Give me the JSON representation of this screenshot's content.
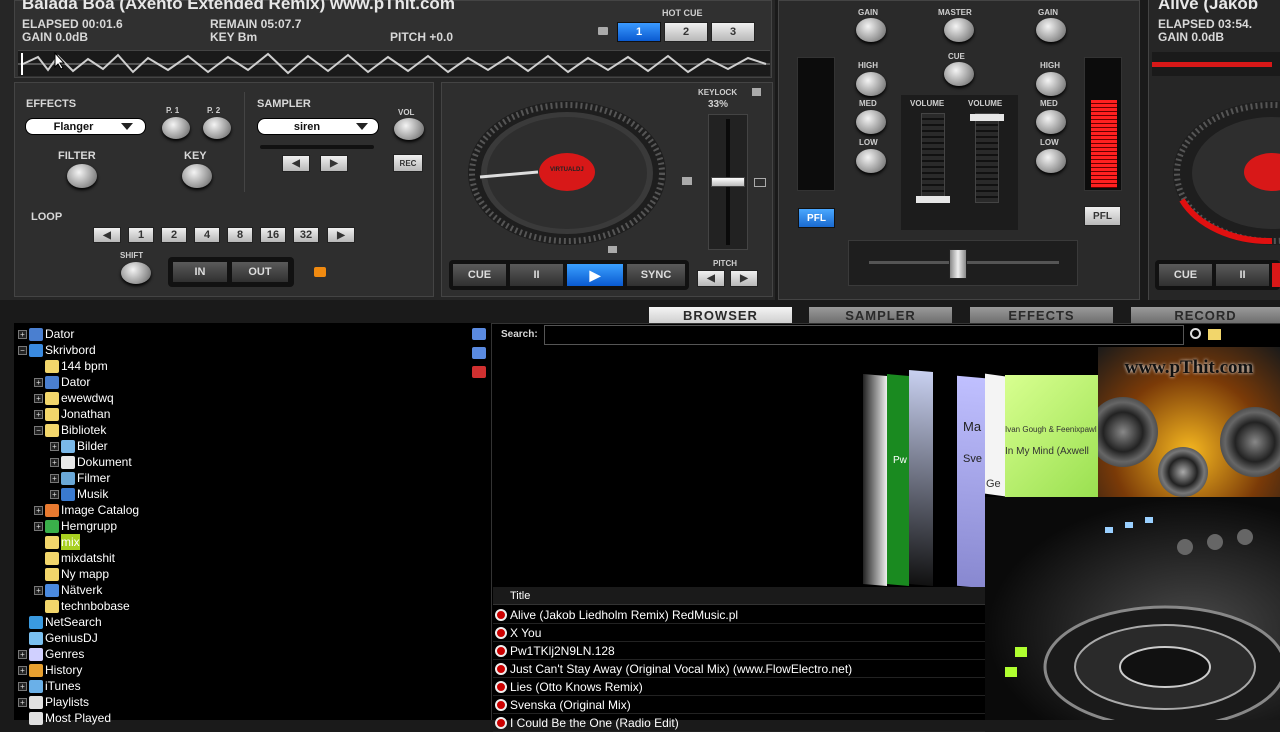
{
  "deck_left": {
    "title": "Balada Boa (Axento Extended Remix) www.pThit.com",
    "elapsed": "ELAPSED 00:01.6",
    "remain": "REMAIN 05:07.7",
    "gain": "GAIN 0.0dB",
    "key": "KEY Bm",
    "pitch": "PITCH +0.0",
    "hot_cue_label": "HOT CUE",
    "hot_cues": [
      "1",
      "2",
      "3"
    ],
    "effects_label": "EFFECTS",
    "effect_selected": "Flanger",
    "p1": "P. 1",
    "p2": "P. 2",
    "filter": "FILTER",
    "key_label": "KEY",
    "sampler_label": "SAMPLER",
    "sample_selected": "siren",
    "vol": "VOL",
    "rec": "REC",
    "loop": "LOOP",
    "loop_values": [
      "1",
      "2",
      "4",
      "8",
      "16",
      "32"
    ],
    "shift": "SHIFT",
    "in": "IN",
    "out": "OUT",
    "keylock": "KEYLOCK",
    "keylock_value": "33%",
    "pitch_label": "PITCH",
    "cue": "CUE",
    "pause": "II",
    "play": "▶",
    "sync": "SYNC",
    "platter_label": "VIRTUALDJ"
  },
  "mixer": {
    "gain_l": "GAIN",
    "gain_r": "GAIN",
    "master": "MASTER",
    "cue": "CUE",
    "high_l": "HIGH",
    "high_r": "HIGH",
    "med_l": "MED",
    "med_r": "MED",
    "low_l": "LOW",
    "low_r": "LOW",
    "volume_l": "VOLUME",
    "volume_r": "VOLUME",
    "pfl_l": "PFL",
    "pfl_r": "PFL"
  },
  "deck_right": {
    "title": "Alive (Jakob",
    "elapsed": "ELAPSED 03:54.",
    "gain": "GAIN 0.0dB",
    "cue": "CUE",
    "pause": "II"
  },
  "tabs": [
    "BROWSER",
    "SAMPLER",
    "EFFECTS",
    "RECORD"
  ],
  "search_label": "Search:",
  "search_value": "",
  "tree": [
    {
      "label": "Dator",
      "depth": 0,
      "exp": "+",
      "icon": "computer-icon",
      "color": "#4a7fd0"
    },
    {
      "label": "Skrivbord",
      "depth": 0,
      "exp": "−",
      "icon": "desktop-icon",
      "color": "#3a8ae0"
    },
    {
      "label": "144 bpm",
      "depth": 1,
      "exp": "",
      "icon": "folder-icon",
      "color": "#f2d66b"
    },
    {
      "label": "Dator",
      "depth": 1,
      "exp": "+",
      "icon": "computer-icon",
      "color": "#4a7fd0"
    },
    {
      "label": "ewewdwq",
      "depth": 1,
      "exp": "+",
      "icon": "folder-icon",
      "color": "#f2d66b"
    },
    {
      "label": "Jonathan",
      "depth": 1,
      "exp": "+",
      "icon": "user-folder-icon",
      "color": "#f2d66b"
    },
    {
      "label": "Bibliotek",
      "depth": 1,
      "exp": "−",
      "icon": "library-icon",
      "color": "#f2d66b"
    },
    {
      "label": "Bilder",
      "depth": 2,
      "exp": "+",
      "icon": "pictures-icon",
      "color": "#7ab8e8"
    },
    {
      "label": "Dokument",
      "depth": 2,
      "exp": "+",
      "icon": "documents-icon",
      "color": "#e8e8e8"
    },
    {
      "label": "Filmer",
      "depth": 2,
      "exp": "+",
      "icon": "videos-icon",
      "color": "#6aa8d8"
    },
    {
      "label": "Musik",
      "depth": 2,
      "exp": "+",
      "icon": "music-icon",
      "color": "#3a7ad0"
    },
    {
      "label": "Image Catalog",
      "depth": 1,
      "exp": "+",
      "icon": "image-catalog-icon",
      "color": "#e87a30"
    },
    {
      "label": "Hemgrupp",
      "depth": 1,
      "exp": "+",
      "icon": "homegroup-icon",
      "color": "#3ab04a"
    },
    {
      "label": "mix",
      "depth": 1,
      "exp": "",
      "icon": "folder-icon",
      "color": "#f2d66b",
      "selected": true
    },
    {
      "label": "mixdatshit",
      "depth": 1,
      "exp": "",
      "icon": "folder-icon",
      "color": "#f2d66b"
    },
    {
      "label": "Ny mapp",
      "depth": 1,
      "exp": "",
      "icon": "folder-icon",
      "color": "#f2d66b"
    },
    {
      "label": "Nätverk",
      "depth": 1,
      "exp": "+",
      "icon": "network-icon",
      "color": "#4a8ae0"
    },
    {
      "label": "technbobase",
      "depth": 1,
      "exp": "",
      "icon": "folder-icon",
      "color": "#f2d66b"
    },
    {
      "label": "NetSearch",
      "depth": 0,
      "exp": "",
      "icon": "netsearch-icon",
      "color": "#3a9ae0"
    },
    {
      "label": "GeniusDJ",
      "depth": 0,
      "exp": "",
      "icon": "geniusdj-icon",
      "color": "#7ac0f0"
    },
    {
      "label": "Genres",
      "depth": 0,
      "exp": "+",
      "icon": "genres-icon",
      "color": "#d0d0ff"
    },
    {
      "label": "History",
      "depth": 0,
      "exp": "+",
      "icon": "history-icon",
      "color": "#e8a030"
    },
    {
      "label": "iTunes",
      "depth": 0,
      "exp": "+",
      "icon": "itunes-icon",
      "color": "#6ab0e8"
    },
    {
      "label": "Playlists",
      "depth": 0,
      "exp": "+",
      "icon": "playlists-icon",
      "color": "#e0e0e0"
    },
    {
      "label": "Most Played",
      "depth": 0,
      "exp": "",
      "icon": "most-played-icon",
      "color": "#e0e0e0"
    }
  ],
  "tracks_header": "Title",
  "tracks": [
    "Alive (Jakob Liedholm Remix) RedMusic.pl",
    "X You",
    "Pw1TKlj2N9LN.128",
    "Just Can't Stay Away (Original Vocal Mix) (www.FlowElectro.net)",
    "Lies (Otto Knows Remix)",
    "Svenska (Original Mix)",
    "I Could Be the One (Radio Edit)"
  ],
  "cover_flow_texts": [
    "Pw",
    "Ma",
    "Sve",
    "Ge",
    "Ivan Gough & Feenixpawl Feat. G",
    "In My Mind (Axwell"
  ],
  "watermark": "www.pThit.com"
}
